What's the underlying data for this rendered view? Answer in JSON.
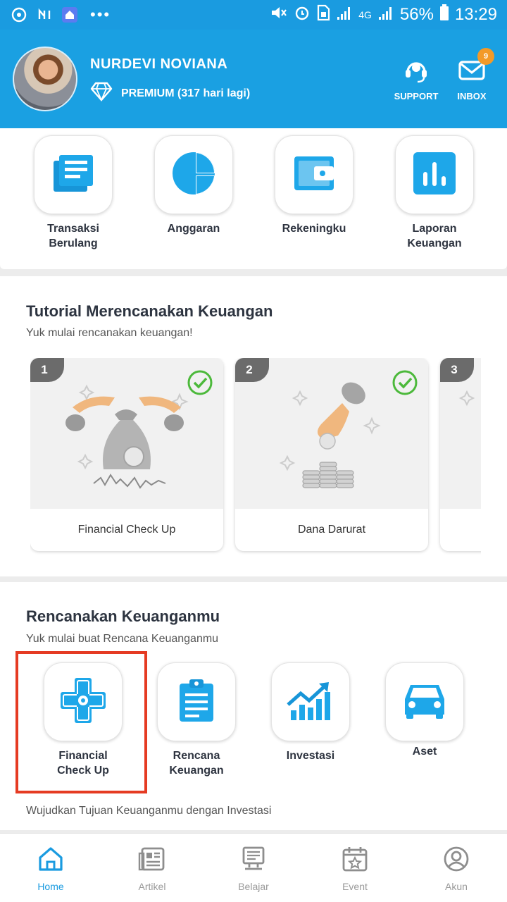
{
  "status_bar": {
    "battery_percent": "56%",
    "time": "13:29",
    "network": "4G"
  },
  "header": {
    "user_name": "NURDEVI NOVIANA",
    "membership": "PREMIUM (317 hari lagi)",
    "support_label": "SUPPORT",
    "inbox_label": "INBOX",
    "inbox_badge": "9"
  },
  "quick_menu": [
    {
      "label": "Transaksi Berulang",
      "icon": "list-icon"
    },
    {
      "label": "Anggaran",
      "icon": "pie-chart-icon"
    },
    {
      "label": "Rekeningku",
      "icon": "wallet-icon"
    },
    {
      "label": "Laporan Keuangan",
      "icon": "bar-chart-icon"
    }
  ],
  "tutorial": {
    "title": "Tutorial Merencanakan Keuangan",
    "subtitle": "Yuk mulai rencanakan keuangan!",
    "cards": [
      {
        "number": "1",
        "label": "Financial Check Up",
        "completed": true
      },
      {
        "number": "2",
        "label": "Dana Darurat",
        "completed": true
      },
      {
        "number": "3",
        "label": "",
        "completed": false
      }
    ]
  },
  "plan": {
    "title": "Rencanakan Keuanganmu",
    "subtitle": "Yuk mulai buat Rencana Keuanganmu",
    "items": [
      {
        "label": "Financial Check Up",
        "icon": "medical-cross-icon"
      },
      {
        "label": "Rencana Keuangan",
        "icon": "clipboard-icon"
      },
      {
        "label": "Investasi",
        "icon": "growth-chart-icon"
      },
      {
        "label": "Aset",
        "icon": "car-icon"
      }
    ],
    "footer": "Wujudkan Tujuan Keuanganmu dengan Investasi"
  },
  "bottom_nav": [
    {
      "label": "Home",
      "icon": "home-icon",
      "active": true
    },
    {
      "label": "Artikel",
      "icon": "article-icon",
      "active": false
    },
    {
      "label": "Belajar",
      "icon": "learn-icon",
      "active": false
    },
    {
      "label": "Event",
      "icon": "calendar-icon",
      "active": false
    },
    {
      "label": "Akun",
      "icon": "account-icon",
      "active": false
    }
  ],
  "colors": {
    "brand": "#1aa0e2",
    "check": "#4cb93b",
    "highlight": "#e53b23",
    "badge": "#f39a28"
  }
}
